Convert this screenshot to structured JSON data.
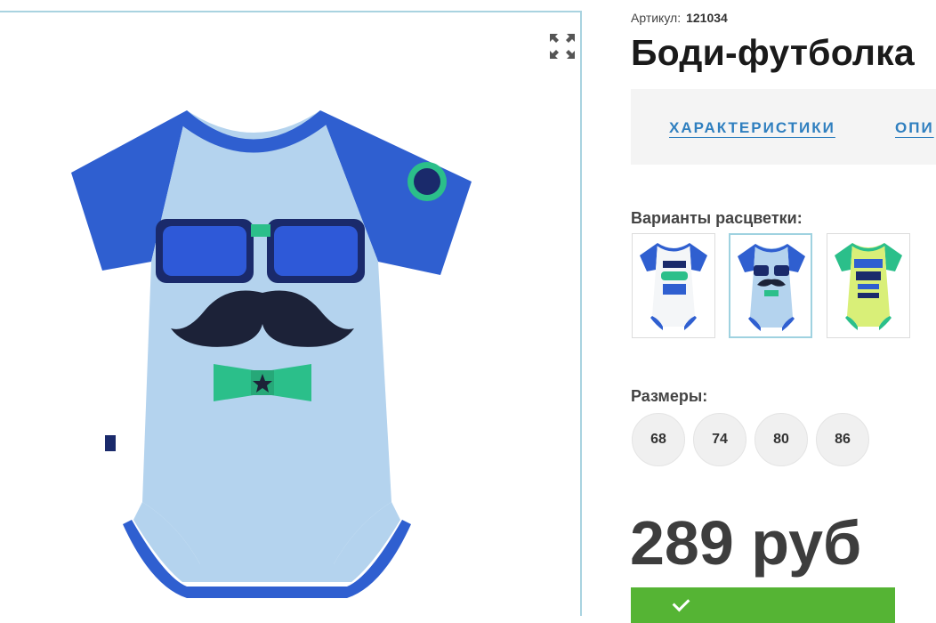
{
  "product": {
    "article_label": "Артикул:",
    "article_number": "121034",
    "title": "Боди-футболка"
  },
  "tabs": [
    {
      "label": "ХАРАКТЕРИСТИКИ"
    },
    {
      "label": "ОПИ"
    }
  ],
  "colors_section": {
    "label": "Варианты расцветки:",
    "variants": [
      {
        "name": "nerd-class-99-white",
        "selected": false
      },
      {
        "name": "glasses-mustache-light-blue",
        "selected": true
      },
      {
        "name": "i-am-nerd-yellow",
        "selected": false
      }
    ]
  },
  "sizes_section": {
    "label": "Размеры:",
    "sizes": [
      "68",
      "74",
      "80",
      "86"
    ]
  },
  "price": "289 руб",
  "colors": {
    "accent_blue": "#2f7fbf",
    "buy_green": "#55b434",
    "panel_border": "#a9d3e0"
  }
}
